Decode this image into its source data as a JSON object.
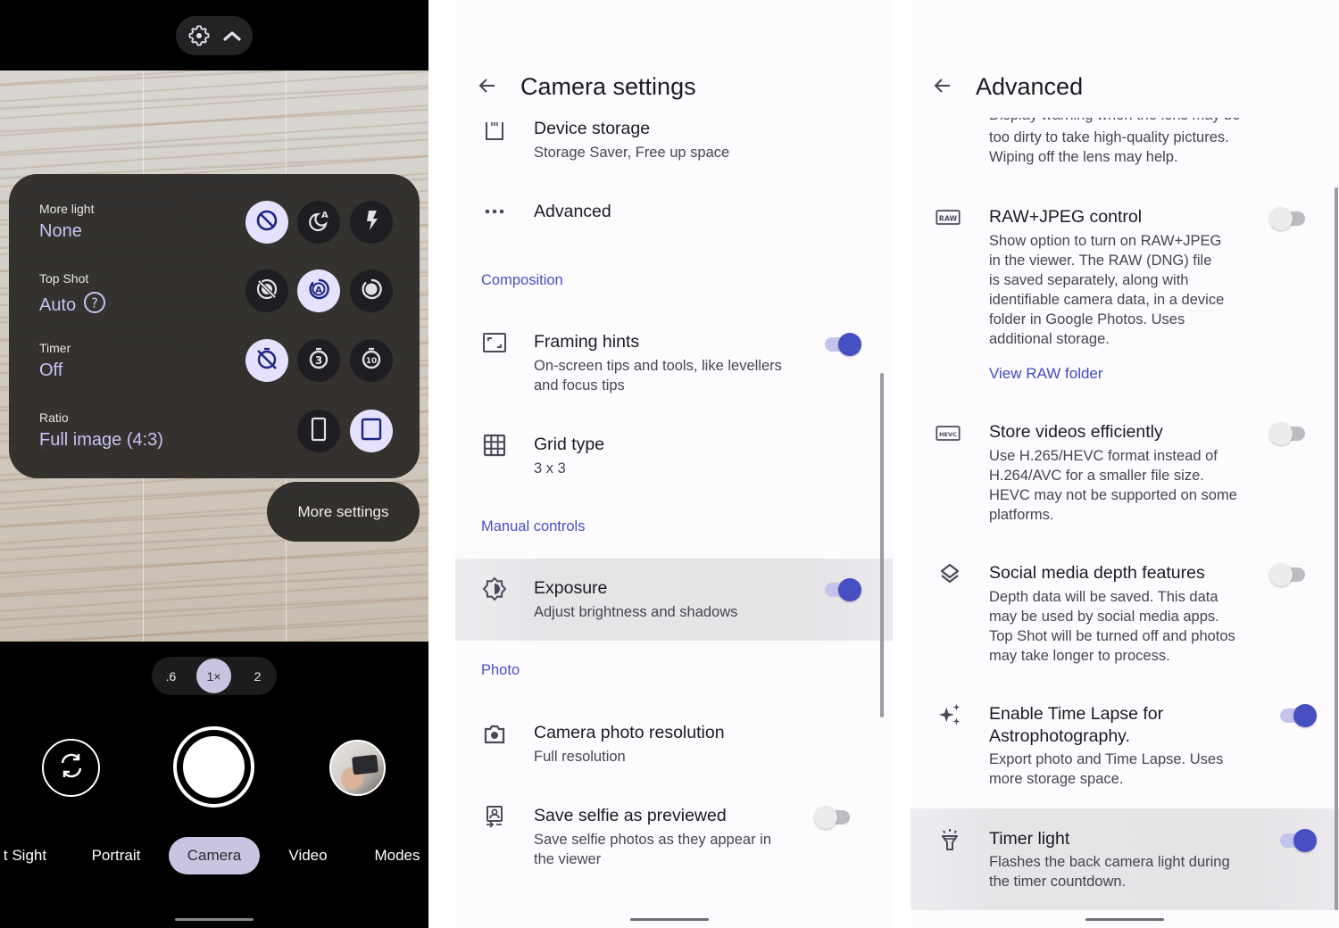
{
  "camera": {
    "top_controls": {
      "settings_icon": "gear-icon",
      "collapse_icon": "chevron-up-icon"
    },
    "quick_settings": [
      {
        "label": "More light",
        "value": "None",
        "options": [
          {
            "icon": "none-icon",
            "selected": true
          },
          {
            "icon": "night-auto-icon",
            "selected": false
          },
          {
            "icon": "flash-icon",
            "selected": false
          }
        ]
      },
      {
        "label": "Top Shot",
        "value": "Auto",
        "help_icon": "help-icon",
        "options": [
          {
            "icon": "top-shot-off-icon",
            "selected": false
          },
          {
            "icon": "top-shot-auto-icon",
            "selected": true
          },
          {
            "icon": "top-shot-on-icon",
            "selected": false
          }
        ]
      },
      {
        "label": "Timer",
        "value": "Off",
        "options": [
          {
            "icon": "timer-off-icon",
            "selected": true
          },
          {
            "icon": "timer-3-icon",
            "selected": false,
            "text": "3"
          },
          {
            "icon": "timer-10-icon",
            "selected": false,
            "text": "10"
          }
        ]
      },
      {
        "label": "Ratio",
        "value": "Full image (4:3)",
        "options": [
          {
            "icon": "ratio-wide-icon",
            "selected": false
          },
          {
            "icon": "ratio-full-icon",
            "selected": true
          }
        ]
      }
    ],
    "more_settings_label": "More settings",
    "zoom_levels": [
      {
        "label": ".6",
        "selected": false
      },
      {
        "label": "1×",
        "selected": true
      },
      {
        "label": "2",
        "selected": false
      }
    ],
    "modes": [
      {
        "label": "t Sight",
        "selected": false
      },
      {
        "label": "Portrait",
        "selected": false
      },
      {
        "label": "Camera",
        "selected": true
      },
      {
        "label": "Video",
        "selected": false
      },
      {
        "label": "Modes",
        "selected": false
      }
    ]
  },
  "camera_settings": {
    "title": "Camera settings",
    "items": [
      {
        "icon": "sd-card-icon",
        "title": "Device storage",
        "subtitle": "Storage Saver, Free up space"
      },
      {
        "icon": "more-horiz-icon",
        "title": "Advanced"
      }
    ],
    "sections": [
      {
        "header": "Composition",
        "items": [
          {
            "icon": "framing-icon",
            "title": "Framing hints",
            "subtitle_lines": [
              "On-screen tips and tools, like levellers",
              "and focus tips"
            ],
            "toggle": true
          },
          {
            "icon": "grid-icon",
            "title": "Grid type",
            "subtitle": "3 x 3"
          }
        ]
      },
      {
        "header": "Manual controls",
        "items": [
          {
            "icon": "exposure-icon",
            "title": "Exposure",
            "subtitle": "Adjust brightness and shadows",
            "toggle": true,
            "highlighted": true
          }
        ]
      },
      {
        "header": "Photo",
        "items": [
          {
            "icon": "camera-icon",
            "title": "Camera photo resolution",
            "subtitle": "Full resolution"
          },
          {
            "icon": "selfie-icon",
            "title": "Save selfie as previewed",
            "subtitle_lines": [
              "Save selfie photos as they appear in",
              "the viewer"
            ],
            "toggle": false
          }
        ]
      }
    ]
  },
  "advanced": {
    "title": "Advanced",
    "partial_text_lines": [
      "Display warning when the lens may be",
      "too dirty to take high-quality pictures.",
      "Wiping off the lens may help."
    ],
    "items": [
      {
        "icon": "raw-icon",
        "icon_text": "RAW",
        "title": "RAW+JPEG control",
        "subtitle_lines": [
          "Show option to turn on RAW+JPEG",
          "in the viewer. The RAW (DNG) file",
          "is saved separately, along with",
          "identifiable camera data, in a device",
          "folder in Google Photos. Uses",
          "additional storage."
        ],
        "link": "View RAW folder",
        "toggle": false
      },
      {
        "icon": "hevc-icon",
        "icon_text": "HEVC",
        "title": "Store videos efficiently",
        "subtitle_lines": [
          "Use H.265/HEVC format instead of",
          "H.264/AVC for a smaller file size.",
          "HEVC may not be supported on some",
          "platforms."
        ],
        "toggle": false
      },
      {
        "icon": "layers-icon",
        "title": "Social media depth features",
        "subtitle_lines": [
          "Depth data will be saved. This data",
          "may be used by social media apps.",
          "Top Shot will be turned off and photos",
          "may take longer to process."
        ],
        "toggle": false
      },
      {
        "icon": "sparkle-icon",
        "title_lines": [
          "Enable Time Lapse for",
          "Astrophotography."
        ],
        "subtitle_lines": [
          "Export photo and Time Lapse. Uses",
          "more storage space."
        ],
        "toggle": true
      },
      {
        "icon": "flashlight-icon",
        "title": "Timer light",
        "subtitle_lines": [
          "Flashes the back camera light during",
          "the timer countdown."
        ],
        "toggle": true,
        "highlighted": true
      }
    ]
  },
  "colors": {
    "accent": "#4650c0",
    "section_header": "#4850c4",
    "selected_chip": "#e6e1ff",
    "mode_selected": "#c9c4e0"
  }
}
